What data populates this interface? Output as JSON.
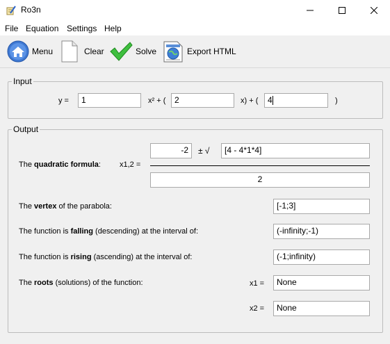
{
  "window": {
    "title": "Ro3n"
  },
  "menu": [
    "File",
    "Equation",
    "Settings",
    "Help"
  ],
  "toolbar": {
    "menu": "Menu",
    "clear": "Clear",
    "solve": "Solve",
    "export": "Export HTML"
  },
  "input": {
    "legend": "Input",
    "y_label": "y =",
    "a": "1",
    "x2_label": "x² + (",
    "b": "2",
    "x_label": "x) + (",
    "c": "4",
    "close": ")"
  },
  "output": {
    "legend": "Output",
    "quad_pre": "The ",
    "quad_bold": "quadratic formula",
    "quad_post": ":",
    "x12_label": "x1,2 =",
    "neg_b": "-2",
    "pm_sqrt": "± √",
    "discriminant": "[4 - 4*1*4]",
    "denominator": "2",
    "vertex_pre": "The ",
    "vertex_bold": "vertex",
    "vertex_post": " of the parabola:",
    "vertex": "[-1;3]",
    "falling_pre": "The function is ",
    "falling_bold": "falling",
    "falling_post": " (descending) at the interval of:",
    "falling": "(-infinity;-1)",
    "rising_pre": "The function is ",
    "rising_bold": "rising",
    "rising_post": " (ascending) at the interval of:",
    "rising": "(-1;infinity)",
    "roots_pre": "The ",
    "roots_bold": "roots",
    "roots_post": " (solutions) of the function:",
    "x1_label": "x1 =",
    "x1": "None",
    "x2_label": "x2 =",
    "x2": "None"
  }
}
